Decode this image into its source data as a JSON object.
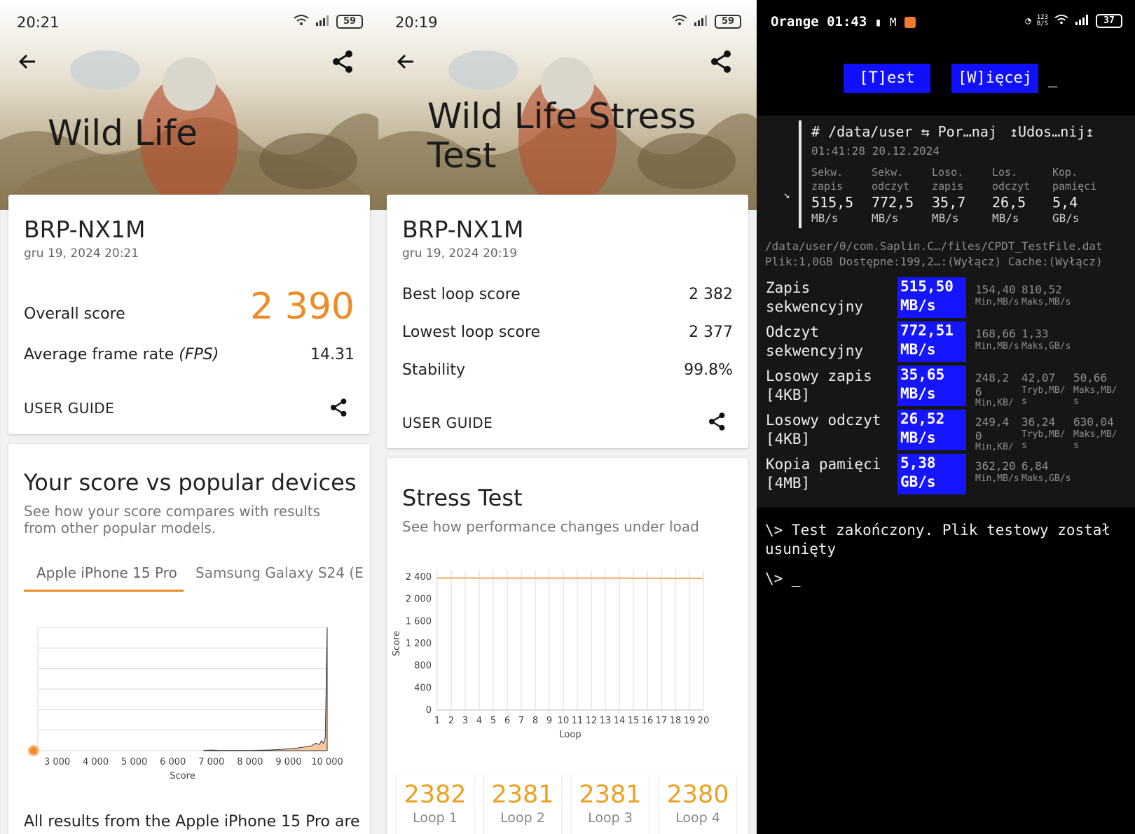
{
  "panel1": {
    "status": {
      "time": "20:21",
      "battery": "59"
    },
    "hero_title": "Wild Life",
    "device": "BRP-NX1M",
    "date": "gru 19, 2024 20:21",
    "overall_label": "Overall score",
    "overall_value": "2 390",
    "fps_label": "Average frame rate",
    "fps_unit": "(FPS)",
    "fps_value": "14.31",
    "user_guide": "USER GUIDE",
    "compare_title": "Your score vs popular devices",
    "compare_sub": "See how your score compares with results from other popular models.",
    "tabs": [
      "Apple iPhone 15 Pro",
      "Samsung Galaxy S24 (E›"
    ],
    "chart_xlabel": "Score",
    "footer_text": "All results from the Apple iPhone 15 Pro are"
  },
  "panel2": {
    "status": {
      "time": "20:19",
      "battery": "59"
    },
    "hero_title_line1": "Wild Life Stress",
    "hero_title_line2": "Test",
    "device": "BRP-NX1M",
    "date": "gru 19, 2024 20:19",
    "rows": [
      {
        "label": "Best loop score",
        "value": "2 382"
      },
      {
        "label": "Lowest loop score",
        "value": "2 377"
      },
      {
        "label": "Stability",
        "value": "99.8%"
      }
    ],
    "user_guide": "USER GUIDE",
    "stress_title": "Stress Test",
    "stress_sub": "See how performance changes under load",
    "loops": [
      {
        "value": "2382",
        "label": "Loop 1"
      },
      {
        "value": "2381",
        "label": "Loop 2"
      },
      {
        "value": "2381",
        "label": "Loop 3"
      },
      {
        "value": "2380",
        "label": "Loop 4"
      }
    ]
  },
  "panel3": {
    "status": {
      "carrier": "Orange",
      "time": "01:43",
      "battery": "37",
      "net": "123\nB/S"
    },
    "buttons": [
      "[T]est",
      "[W]ięcej"
    ],
    "cursor": "_",
    "header": {
      "hash": "#",
      "path": "/data/user",
      "compare": "⇆ Por…naj",
      "share": "↥Udos…nij↥",
      "timestamp": "01:41:28 20.12.2024"
    },
    "summary": [
      {
        "l1": "Sekw.",
        "l2": "zapis",
        "v": "515,5",
        "u": "MB/s"
      },
      {
        "l1": "Sekw.",
        "l2": "odczyt",
        "v": "772,5",
        "u": "MB/s"
      },
      {
        "l1": "Loso.",
        "l2": "zapis",
        "v": "35,7",
        "u": "MB/s"
      },
      {
        "l1": "Los.",
        "l2": "odczyt",
        "v": "26,5",
        "u": "MB/s"
      },
      {
        "l1": "Kop.",
        "l2": "pamięci",
        "v": "5,4",
        "u": "GB/s"
      }
    ],
    "file_path": "/data/user/0/com.Saplin.C…/files/CPDT_TestFile.dat",
    "file_info": "Plik:1,0GB Dostępne:199,2…:(Wyłącz) Cache:(Wyłącz)",
    "ops": [
      {
        "l1": "Zapis",
        "l2": "sekwencyjny",
        "v1": "515,50",
        "v2": "MB/s",
        "a": "154,40",
        "au": "Min,MB/s",
        "b": "810,52",
        "bu": "Maks,MB/s",
        "c": "",
        "cu": ""
      },
      {
        "l1": "Odczyt",
        "l2": "sekwencyjny",
        "v1": "772,51",
        "v2": "MB/s",
        "a": "168,66",
        "au": "Min,MB/s",
        "b": "1,33",
        "bu": "Maks,GB/s",
        "c": "",
        "cu": ""
      },
      {
        "l1": "Losowy zapis",
        "l2": "[4KB]",
        "v1": "35,65",
        "v2": "MB/s",
        "a": "248,2\n6",
        "au": "Min,KB/",
        "b": "42,07",
        "bu": "Tryb,MB/\ns",
        "c": "50,66",
        "cu": "Maks,MB/\ns"
      },
      {
        "l1": "Losowy odczyt",
        "l2": "[4KB]",
        "v1": "26,52",
        "v2": "MB/s",
        "a": "249,4\n0",
        "au": "Min,KB/",
        "b": "36,24",
        "bu": "Tryb,MB/\ns",
        "c": "630,04",
        "cu": "Maks,MB/\ns"
      },
      {
        "l1": "Kopia pamięci",
        "l2": "[4MB]",
        "v1": "5,38",
        "v2": "GB/s",
        "a": "362,20",
        "au": "Min,MB/s",
        "b": "6,84",
        "bu": "Maks,GB/s",
        "c": "",
        "cu": ""
      }
    ],
    "done_msg": "\\> Test zakończony. Plik testowy został usunięty",
    "prompt": "\\> _"
  },
  "chart_data": [
    {
      "type": "area",
      "title": "",
      "xlabel": "Score",
      "ylabel": "",
      "xlim": [
        2500,
        10000
      ],
      "x_ticks": [
        "3 000",
        "4 000",
        "5 000",
        "6 000",
        "7 000",
        "8 000",
        "9 000",
        "10 000"
      ],
      "marker": {
        "x": 2390,
        "label": ""
      },
      "series": [
        {
          "x": [
            6800,
            7000,
            7200,
            8000,
            8500,
            8800,
            9000,
            9200,
            9400,
            9600,
            9700,
            9800,
            9850,
            9900,
            9950,
            10000
          ],
          "values": [
            0.2,
            0.5,
            0.2,
            0.2,
            0.5,
            1,
            1.5,
            2,
            3,
            4,
            6,
            5,
            8,
            6,
            10,
            100
          ]
        }
      ]
    },
    {
      "type": "line",
      "title": "",
      "xlabel": "Loop",
      "ylabel": "Score",
      "ylim": [
        0,
        2400
      ],
      "y_ticks": [
        "0",
        "400",
        "800",
        "1 200",
        "1 600",
        "2 000",
        "2 400"
      ],
      "categories": [
        "1",
        "2",
        "3",
        "4",
        "5",
        "6",
        "7",
        "8",
        "9",
        "10",
        "11",
        "12",
        "13",
        "14",
        "15",
        "16",
        "17",
        "18",
        "19",
        "20"
      ],
      "series": [
        {
          "values": [
            2382,
            2381,
            2381,
            2380,
            2380,
            2380,
            2380,
            2380,
            2380,
            2379,
            2379,
            2379,
            2379,
            2379,
            2378,
            2378,
            2378,
            2377,
            2378,
            2377
          ]
        }
      ]
    }
  ]
}
